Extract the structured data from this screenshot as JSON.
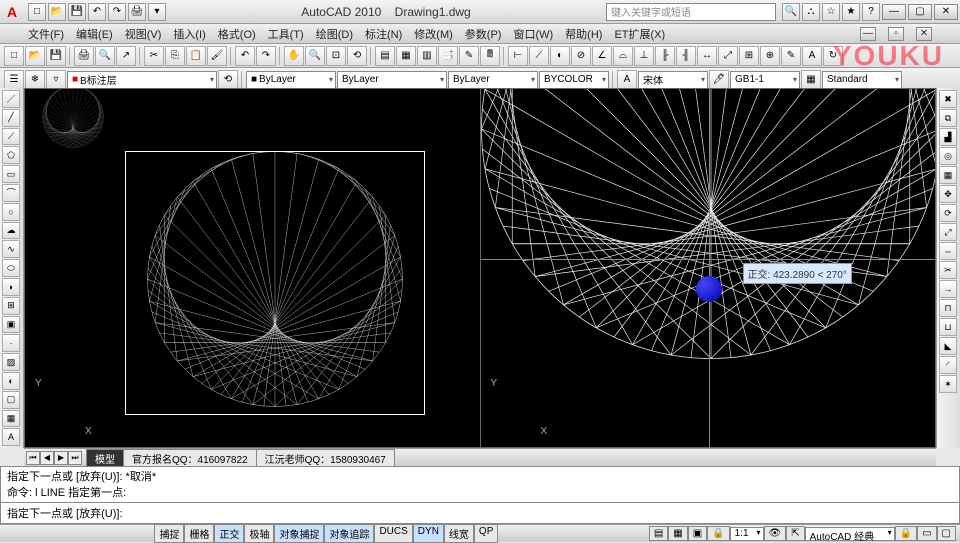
{
  "title": {
    "app": "AutoCAD 2010",
    "doc": "Drawing1.dwg"
  },
  "search_placeholder": "键入关键字或短语",
  "watermark": "YOUKU",
  "menus": [
    "文件(F)",
    "编辑(E)",
    "视图(V)",
    "插入(I)",
    "格式(O)",
    "工具(T)",
    "绘图(D)",
    "标注(N)",
    "修改(M)",
    "参数(P)",
    "窗口(W)",
    "帮助(H)",
    "ET扩展(X)"
  ],
  "layer_combo": "B标注层",
  "props": {
    "color": "ByLayer",
    "linetype": "ByLayer",
    "lineweight": "ByLayer",
    "plotstyle": "BYCOLOR",
    "font": "宋体",
    "textstyle": "GB1-1",
    "dimstyle": "Standard"
  },
  "coord_tip": {
    "label": "正交:",
    "value": "423.2890 < 270°"
  },
  "ucs": {
    "x": "X",
    "y": "Y"
  },
  "tabs": {
    "model": "模型",
    "layout1": "官方报名QQ：416097822",
    "layout2": "江沅老师QQ：1580930467"
  },
  "cmd": {
    "l1": "指定下一点或 [放弃(U)]: *取消*",
    "l2": "命令: l LINE 指定第一点:",
    "l3": "指定下一点或 [放弃(U)]:"
  },
  "status": {
    "buttons": [
      "捕捉",
      "栅格",
      "正交",
      "极轴",
      "对象捕捉",
      "对象追踪",
      "DUCS",
      "DYN",
      "线宽",
      "QP"
    ],
    "on": [
      2,
      4,
      5,
      7
    ],
    "scale": "1:1",
    "workspace": "AutoCAD 经典"
  }
}
